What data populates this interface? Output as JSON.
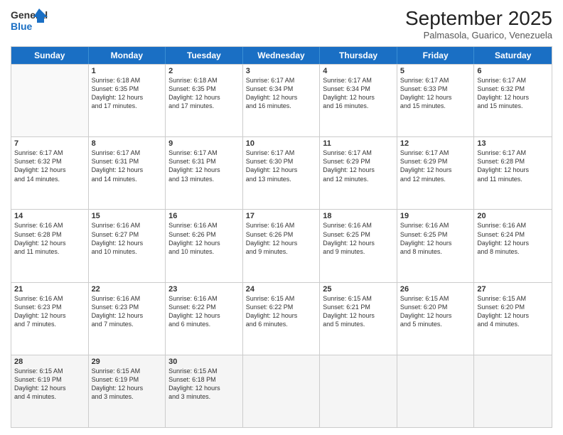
{
  "header": {
    "logo_line1": "General",
    "logo_line2": "Blue",
    "month_title": "September 2025",
    "location": "Palmasola, Guarico, Venezuela"
  },
  "day_headers": [
    "Sunday",
    "Monday",
    "Tuesday",
    "Wednesday",
    "Thursday",
    "Friday",
    "Saturday"
  ],
  "weeks": [
    [
      {
        "date": "",
        "info": ""
      },
      {
        "date": "1",
        "info": "Sunrise: 6:18 AM\nSunset: 6:35 PM\nDaylight: 12 hours\nand 17 minutes."
      },
      {
        "date": "2",
        "info": "Sunrise: 6:18 AM\nSunset: 6:35 PM\nDaylight: 12 hours\nand 17 minutes."
      },
      {
        "date": "3",
        "info": "Sunrise: 6:17 AM\nSunset: 6:34 PM\nDaylight: 12 hours\nand 16 minutes."
      },
      {
        "date": "4",
        "info": "Sunrise: 6:17 AM\nSunset: 6:34 PM\nDaylight: 12 hours\nand 16 minutes."
      },
      {
        "date": "5",
        "info": "Sunrise: 6:17 AM\nSunset: 6:33 PM\nDaylight: 12 hours\nand 15 minutes."
      },
      {
        "date": "6",
        "info": "Sunrise: 6:17 AM\nSunset: 6:32 PM\nDaylight: 12 hours\nand 15 minutes."
      }
    ],
    [
      {
        "date": "7",
        "info": "Sunrise: 6:17 AM\nSunset: 6:32 PM\nDaylight: 12 hours\nand 14 minutes."
      },
      {
        "date": "8",
        "info": "Sunrise: 6:17 AM\nSunset: 6:31 PM\nDaylight: 12 hours\nand 14 minutes."
      },
      {
        "date": "9",
        "info": "Sunrise: 6:17 AM\nSunset: 6:31 PM\nDaylight: 12 hours\nand 13 minutes."
      },
      {
        "date": "10",
        "info": "Sunrise: 6:17 AM\nSunset: 6:30 PM\nDaylight: 12 hours\nand 13 minutes."
      },
      {
        "date": "11",
        "info": "Sunrise: 6:17 AM\nSunset: 6:29 PM\nDaylight: 12 hours\nand 12 minutes."
      },
      {
        "date": "12",
        "info": "Sunrise: 6:17 AM\nSunset: 6:29 PM\nDaylight: 12 hours\nand 12 minutes."
      },
      {
        "date": "13",
        "info": "Sunrise: 6:17 AM\nSunset: 6:28 PM\nDaylight: 12 hours\nand 11 minutes."
      }
    ],
    [
      {
        "date": "14",
        "info": "Sunrise: 6:16 AM\nSunset: 6:28 PM\nDaylight: 12 hours\nand 11 minutes."
      },
      {
        "date": "15",
        "info": "Sunrise: 6:16 AM\nSunset: 6:27 PM\nDaylight: 12 hours\nand 10 minutes."
      },
      {
        "date": "16",
        "info": "Sunrise: 6:16 AM\nSunset: 6:26 PM\nDaylight: 12 hours\nand 10 minutes."
      },
      {
        "date": "17",
        "info": "Sunrise: 6:16 AM\nSunset: 6:26 PM\nDaylight: 12 hours\nand 9 minutes."
      },
      {
        "date": "18",
        "info": "Sunrise: 6:16 AM\nSunset: 6:25 PM\nDaylight: 12 hours\nand 9 minutes."
      },
      {
        "date": "19",
        "info": "Sunrise: 6:16 AM\nSunset: 6:25 PM\nDaylight: 12 hours\nand 8 minutes."
      },
      {
        "date": "20",
        "info": "Sunrise: 6:16 AM\nSunset: 6:24 PM\nDaylight: 12 hours\nand 8 minutes."
      }
    ],
    [
      {
        "date": "21",
        "info": "Sunrise: 6:16 AM\nSunset: 6:23 PM\nDaylight: 12 hours\nand 7 minutes."
      },
      {
        "date": "22",
        "info": "Sunrise: 6:16 AM\nSunset: 6:23 PM\nDaylight: 12 hours\nand 7 minutes."
      },
      {
        "date": "23",
        "info": "Sunrise: 6:16 AM\nSunset: 6:22 PM\nDaylight: 12 hours\nand 6 minutes."
      },
      {
        "date": "24",
        "info": "Sunrise: 6:15 AM\nSunset: 6:22 PM\nDaylight: 12 hours\nand 6 minutes."
      },
      {
        "date": "25",
        "info": "Sunrise: 6:15 AM\nSunset: 6:21 PM\nDaylight: 12 hours\nand 5 minutes."
      },
      {
        "date": "26",
        "info": "Sunrise: 6:15 AM\nSunset: 6:20 PM\nDaylight: 12 hours\nand 5 minutes."
      },
      {
        "date": "27",
        "info": "Sunrise: 6:15 AM\nSunset: 6:20 PM\nDaylight: 12 hours\nand 4 minutes."
      }
    ],
    [
      {
        "date": "28",
        "info": "Sunrise: 6:15 AM\nSunset: 6:19 PM\nDaylight: 12 hours\nand 4 minutes."
      },
      {
        "date": "29",
        "info": "Sunrise: 6:15 AM\nSunset: 6:19 PM\nDaylight: 12 hours\nand 3 minutes."
      },
      {
        "date": "30",
        "info": "Sunrise: 6:15 AM\nSunset: 6:18 PM\nDaylight: 12 hours\nand 3 minutes."
      },
      {
        "date": "",
        "info": ""
      },
      {
        "date": "",
        "info": ""
      },
      {
        "date": "",
        "info": ""
      },
      {
        "date": "",
        "info": ""
      }
    ]
  ]
}
